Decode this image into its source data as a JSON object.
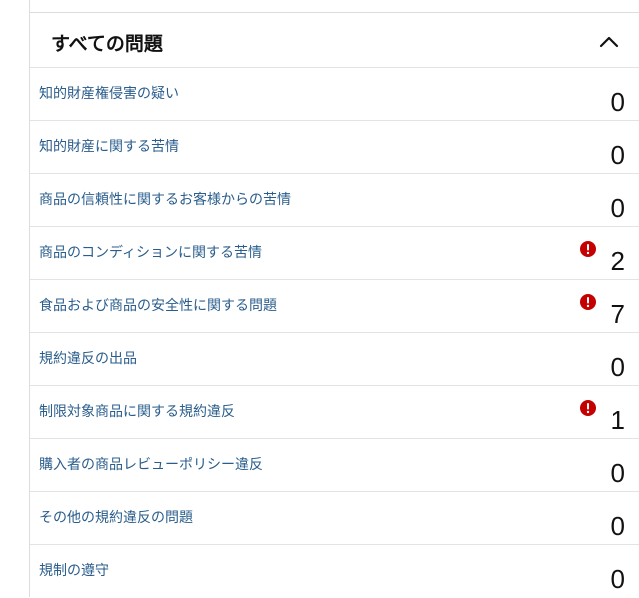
{
  "section": {
    "title": "すべての問題"
  },
  "colors": {
    "link": "#2a5d8c",
    "alert": "#c40000"
  },
  "issues": [
    {
      "label": "知的財産権侵害の疑い",
      "count": "0",
      "alert": false
    },
    {
      "label": "知的財産に関する苦情",
      "count": "0",
      "alert": false
    },
    {
      "label": "商品の信頼性に関するお客様からの苦情",
      "count": "0",
      "alert": false
    },
    {
      "label": "商品のコンディションに関する苦情",
      "count": "2",
      "alert": true
    },
    {
      "label": "食品および商品の安全性に関する問題",
      "count": "7",
      "alert": true
    },
    {
      "label": "規約違反の出品",
      "count": "0",
      "alert": false
    },
    {
      "label": "制限対象商品に関する規約違反",
      "count": "1",
      "alert": true
    },
    {
      "label": "購入者の商品レビューポリシー違反",
      "count": "0",
      "alert": false
    },
    {
      "label": "その他の規約違反の問題",
      "count": "0",
      "alert": false
    },
    {
      "label": "規制の遵守",
      "count": "0",
      "alert": false
    }
  ]
}
